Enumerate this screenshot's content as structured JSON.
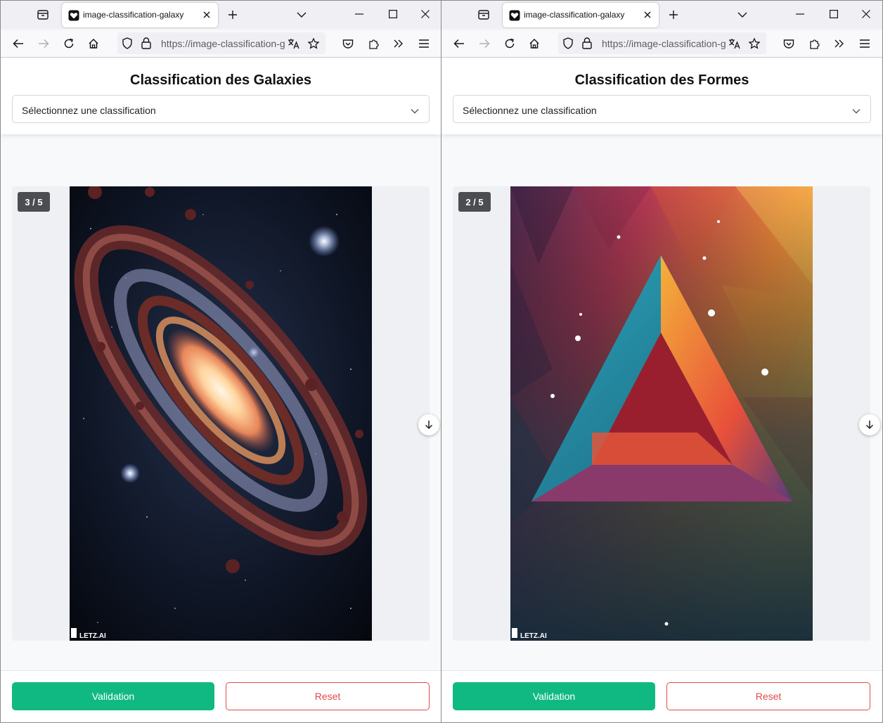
{
  "windows": [
    {
      "tab_title": "image-classification-galaxy",
      "url": "https://image-classification-g",
      "page_title": "Classification des Galaxies",
      "select_placeholder": "Sélectionnez une classification",
      "counter": "3 / 5",
      "image_alt_icon": "galaxy-image",
      "watermark": "LETZ.AI",
      "validate_label": "Validation",
      "reset_label": "Reset"
    },
    {
      "tab_title": "image-classification-galaxy",
      "url": "https://image-classification-g",
      "page_title": "Classification des Formes",
      "select_placeholder": "Sélectionnez une classification",
      "counter": "2 / 5",
      "image_alt_icon": "triangle-shape-image",
      "watermark": "LETZ.AI",
      "validate_label": "Validation",
      "reset_label": "Reset"
    }
  ],
  "colors": {
    "validate": "#10b981",
    "reset": "#e24b4b"
  }
}
